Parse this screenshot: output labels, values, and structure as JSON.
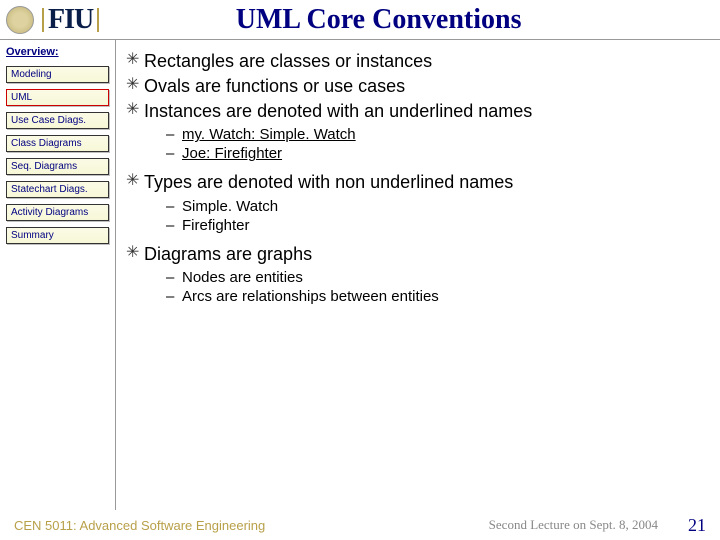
{
  "header": {
    "logo_text": "FIU",
    "title": "UML Core Conventions"
  },
  "sidebar": {
    "heading": "Overview:",
    "items": [
      {
        "label": "Modeling",
        "active": false
      },
      {
        "label": "UML",
        "active": true
      },
      {
        "label": "Use Case Diags.",
        "active": false
      },
      {
        "label": "Class Diagrams",
        "active": false
      },
      {
        "label": "Seq. Diagrams",
        "active": false
      },
      {
        "label": "Statechart Diags.",
        "active": false
      },
      {
        "label": "Activity Diagrams",
        "active": false
      },
      {
        "label": "Summary",
        "active": false
      }
    ]
  },
  "content": {
    "bullets": [
      "Rectangles are classes or instances",
      "Ovals are functions or use cases",
      "Instances are denoted with an underlined names",
      "Types are denoted with non underlined names",
      "Diagrams are graphs"
    ],
    "sub_underlined": [
      "my. Watch: Simple. Watch",
      "Joe: Firefighter"
    ],
    "sub_plain_1": [
      "Simple. Watch",
      "Firefighter"
    ],
    "sub_plain_2": [
      "Nodes are entities",
      "Arcs are relationships between entities"
    ]
  },
  "footer": {
    "left": "CEN 5011: Advanced Software Engineering",
    "mid": "Second Lecture on Sept. 8, 2004",
    "page": "21"
  }
}
